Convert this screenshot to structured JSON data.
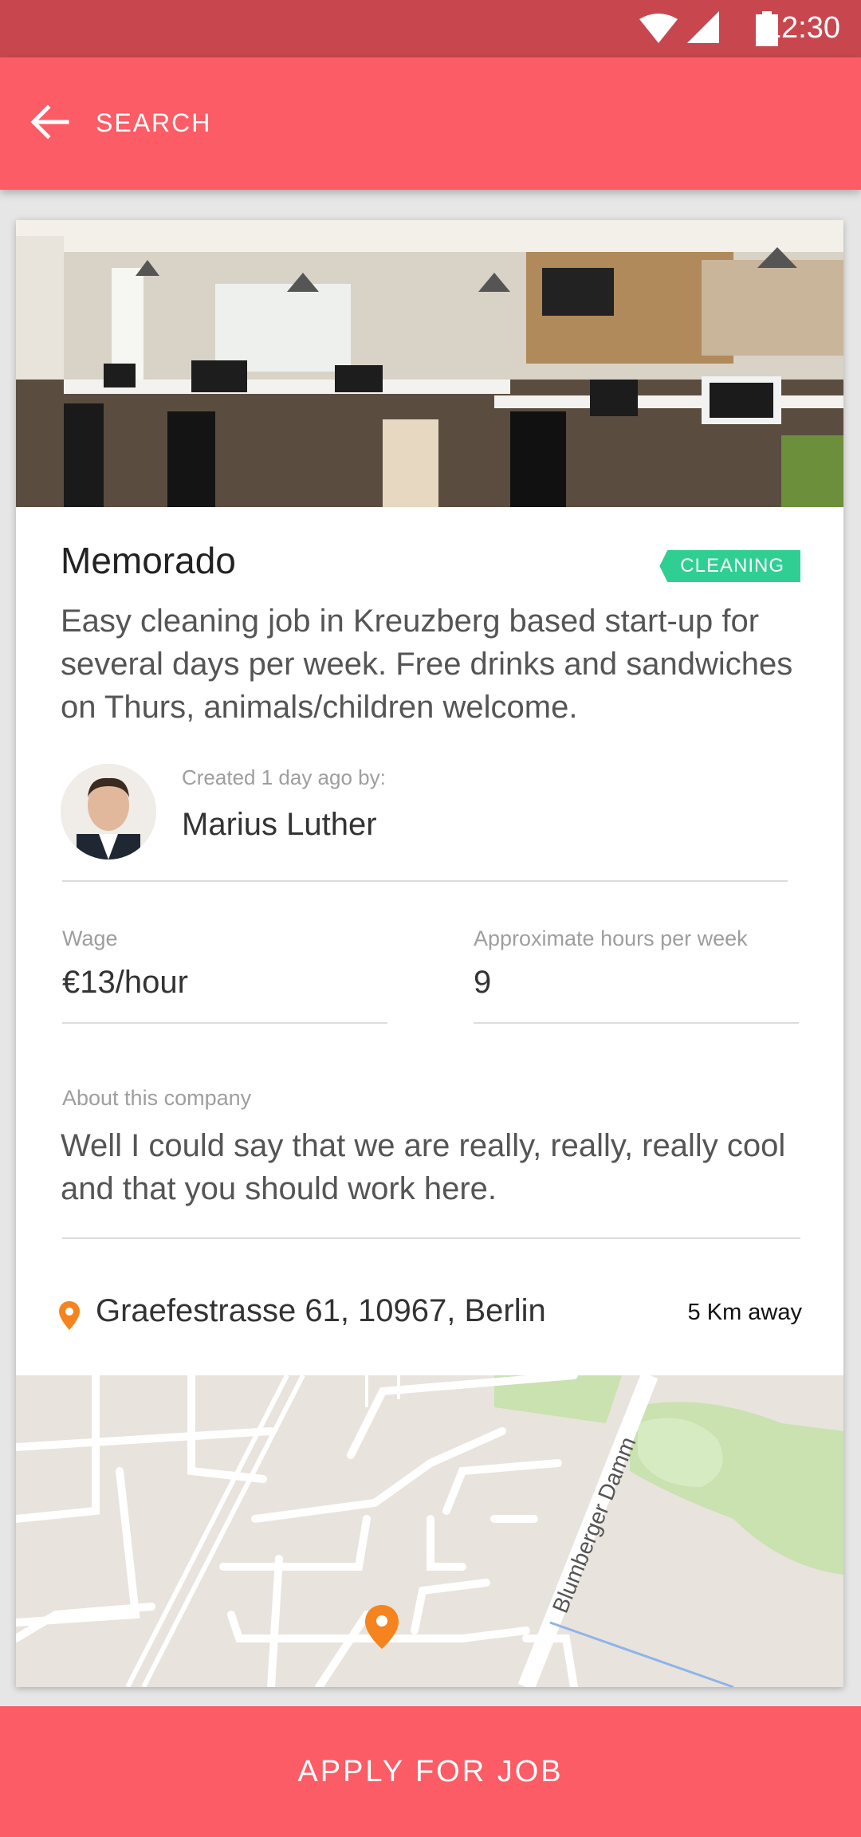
{
  "status_bar": {
    "time": "12:30",
    "icons": [
      "wifi-icon",
      "signal-icon",
      "battery-icon"
    ]
  },
  "app_bar": {
    "back_icon": "arrow-back-icon",
    "title": "SEARCH"
  },
  "job": {
    "company": "Memorado",
    "category": "CLEANING",
    "description": "Easy cleaning job in Kreuzberg based start-up for several days per week. Free drinks and sandwiches on Thurs, animals/children welcome.",
    "created_label": "Created 1 day ago by:",
    "author": "Marius Luther",
    "wage_label": "Wage",
    "wage": "€13/hour",
    "hours_label": "Approximate hours per week",
    "hours": "9",
    "about_label": "About this company",
    "about": "Well I could say that we are really, really, really cool and that you should work here.",
    "address": "Graefestrasse 61, 10967, Berlin",
    "distance": "5 Km away"
  },
  "map": {
    "street_label": "Blumberger Damm"
  },
  "apply_button": "APPLY FOR JOB",
  "colors": {
    "primary": "#fb5c65",
    "status_bar": "#c8474f",
    "tag": "#2fcf93",
    "pin": "#f5841f"
  }
}
